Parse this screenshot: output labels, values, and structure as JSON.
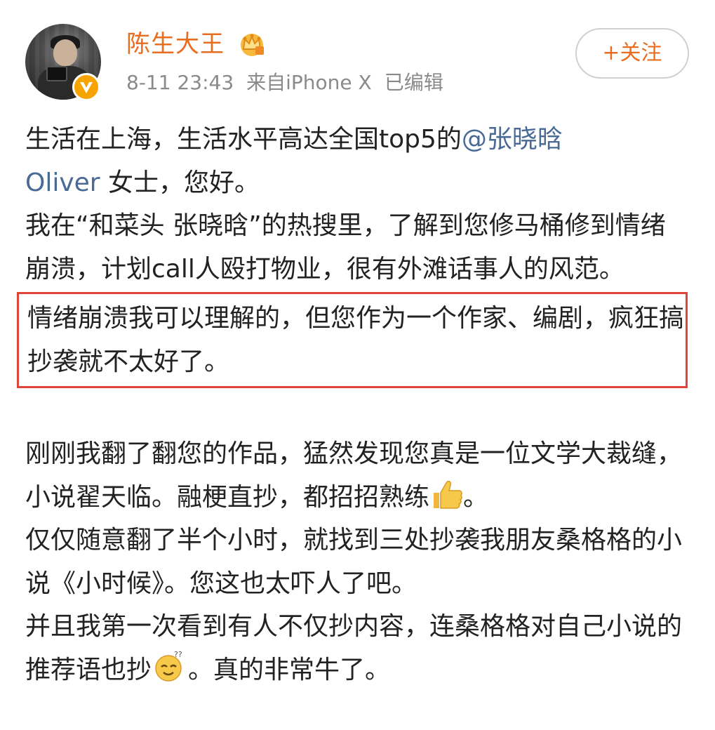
{
  "user": {
    "name": "陈生大王",
    "timestamp": "8-11 23:43",
    "source": "来自iPhone X",
    "edited": "已编辑",
    "follow_label": "+关注"
  },
  "post": {
    "p1_prefix": "生活在上海，生活水平高达全国top5的",
    "p1_mention_part1": "@张晓晗",
    "p1_mention_part2": "Oliver",
    "p1_suffix": " 女士，您好。",
    "p2": "我在“和菜头 张晓晗”的热搜里，了解到您修马桶修到情绪崩溃，计划call人殴打物业，很有外滩话事人的风范。",
    "highlight": "情绪崩溃我可以理解的，但您作为一个作家、编剧，疯狂搞抄袭就不太好了。",
    "p3_before_emoji": "刚刚我翻了翻您的作品，猛然发现您真是一位文学大裁缝，小说翟天临。融梗直抄，都招招熟练",
    "p3_after_emoji": "。",
    "p4": "仅仅随意翻了半个小时，就找到三处抄袭我朋友桑格格的小说《小时候》。您这也太吓人了吧。",
    "p5_before_emoji": "并且我第一次看到有人不仅抄内容，连桑格格对自己小说的推荐语也抄",
    "p5_after_emoji": "。真的非常牛了。"
  },
  "icons": {
    "verified": "verified-v-badge-icon",
    "crown": "crown-member-icon",
    "thumbs_up": "thumbs-up-emoji-icon",
    "dizzy": "dizzy-emoji-icon"
  },
  "colors": {
    "username": "#e86d1f",
    "mention": "#4a6a96",
    "highlight_border": "#e0453a",
    "meta": "#8a8a8a",
    "verified": "#f7a300"
  }
}
